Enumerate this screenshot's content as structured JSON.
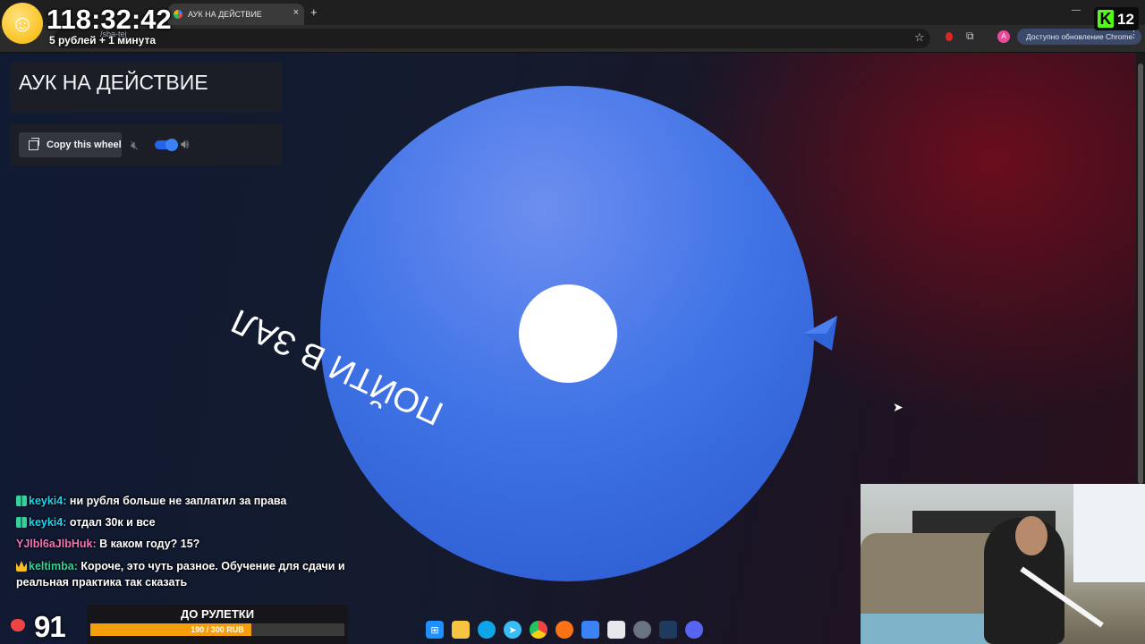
{
  "browser": {
    "tab_title": "АУК НА ДЕЙСТВИЕ",
    "tab_close": "×",
    "new_tab": "+",
    "minimize": "—",
    "url_fragment": "/sba-tej",
    "update_label": "Доступно обновление Chrome",
    "profile_initial": "A"
  },
  "page": {
    "wheel_title": "АУК НА ДЕЙСТВИЕ",
    "copy_label": "Copy this wheel",
    "sound_enabled": true,
    "wheel": {
      "slices": [
        {
          "label": "ПОЙТИ В ЗАЛ",
          "color": "#3f73e6"
        }
      ],
      "pointer_color": "#2f63d8",
      "hub_color": "#ffffff"
    }
  },
  "overlay": {
    "timer": "118:32:42",
    "timer_rate": "5 рублей + 1 минута",
    "kick_logo": "K",
    "kick_count": "12",
    "viewers": "91",
    "roulette_label": "ДО РУЛЕТКИ",
    "roulette_value": "190 / 300 RUB",
    "roulette_progress": 0.633
  },
  "chat": [
    {
      "user": "keyki4:",
      "text": "ни рубля больше не заплатил за права",
      "color": "#22d3ee",
      "badge": "grid"
    },
    {
      "user": "keyki4:",
      "text": "отдал 30к и все",
      "color": "#22d3ee",
      "badge": "grid"
    },
    {
      "user": "YJlbl6aJlbHuk:",
      "text": "В каком году? 15?",
      "color": "#f472b6",
      "badge": "none"
    },
    {
      "user": "keltimba:",
      "text": "Короче, это чуть разное. Обучение для сдачи и реальная практика так сказать",
      "color": "#34d399",
      "badge": "crown"
    }
  ],
  "taskbar": [
    "windows-icon",
    "explorer-icon",
    "edge-icon",
    "telegram-icon",
    "chrome-icon",
    "obs-icon",
    "stats-icon",
    "screenshot-icon",
    "steam-overlay-icon",
    "steam-icon",
    "discord-icon"
  ]
}
